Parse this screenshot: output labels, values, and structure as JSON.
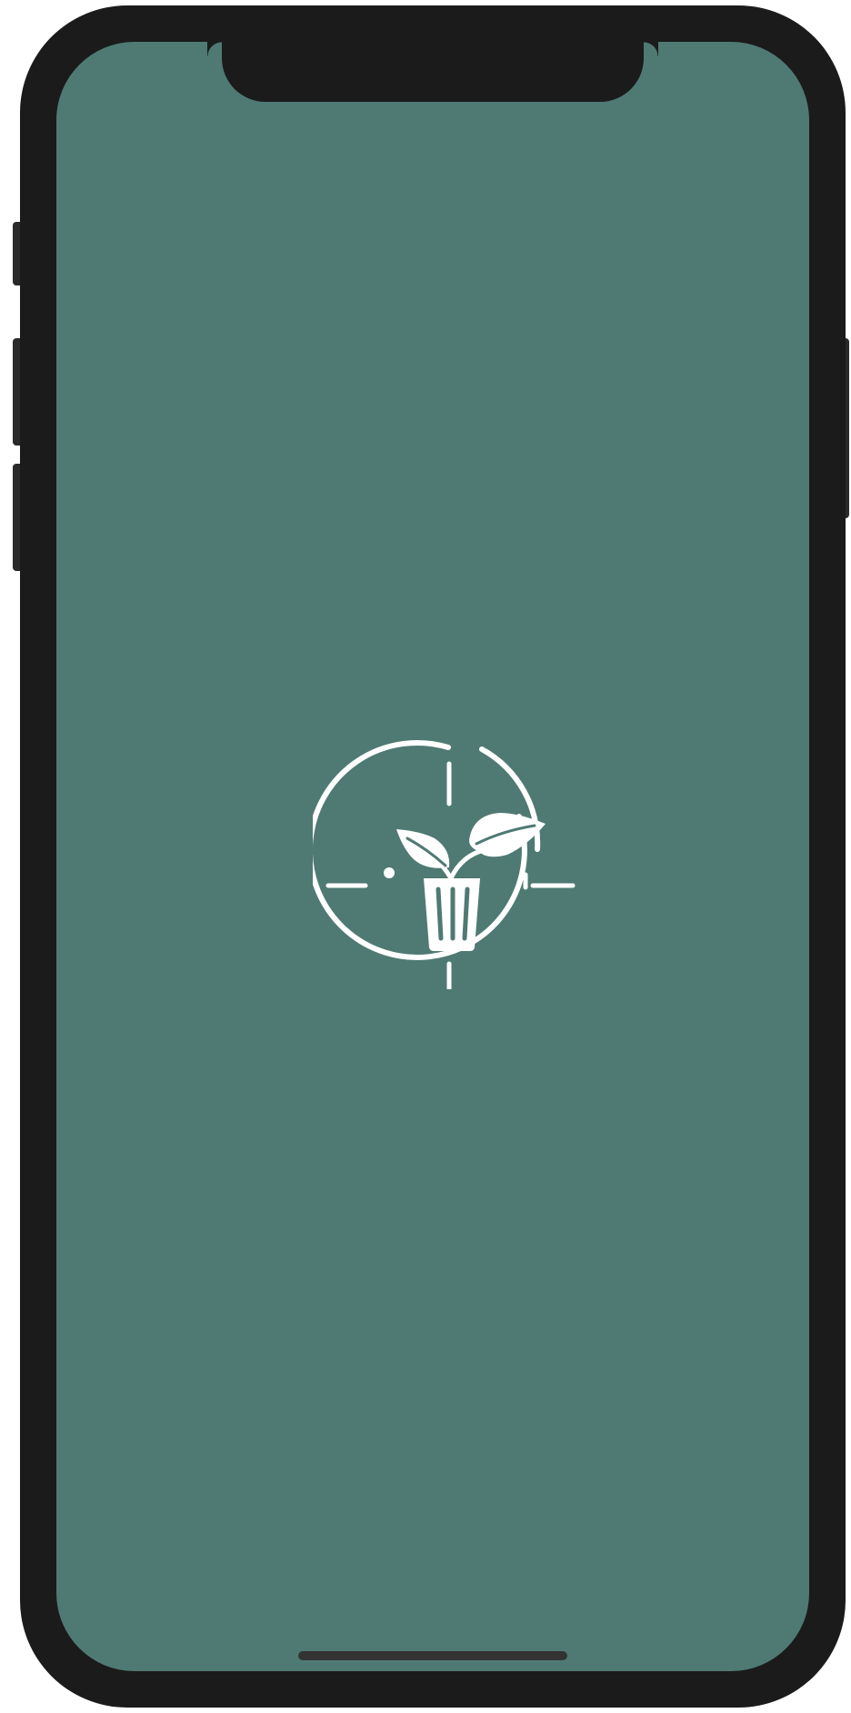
{
  "device": {
    "model": "iphone-x",
    "frame_color": "#1b1b1b"
  },
  "screen": {
    "type": "splash",
    "background_color": "#4f7a73"
  },
  "logo": {
    "icon": "plant-pot-target-icon",
    "color": "#ffffff"
  },
  "home_indicator": {
    "color": "#333333"
  }
}
